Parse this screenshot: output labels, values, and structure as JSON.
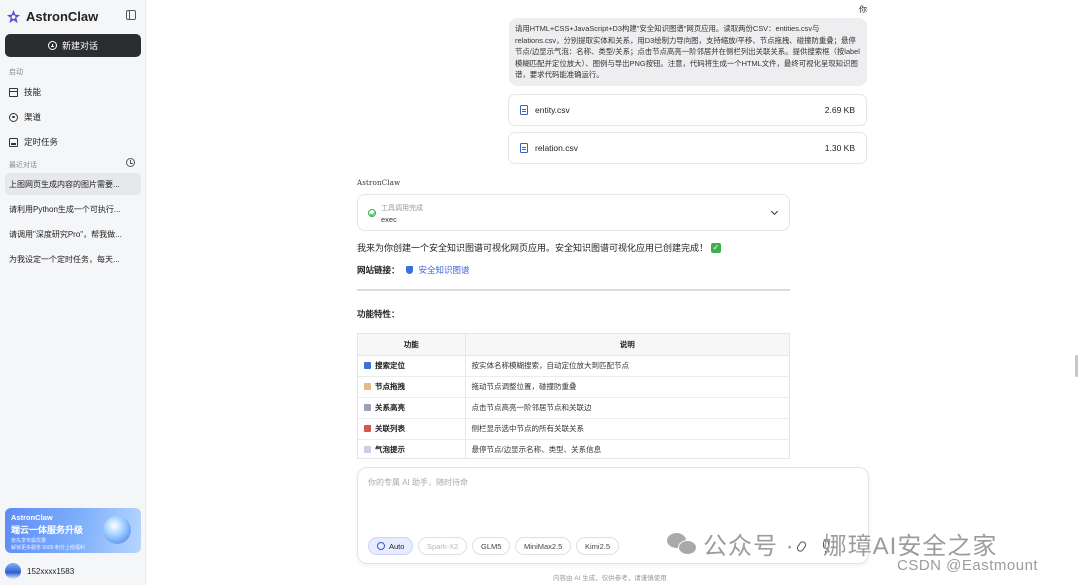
{
  "sidebar": {
    "brand": "AstronClaw",
    "new_chat": "新建对话",
    "start_label": "启动",
    "nav": [
      {
        "label": "技能",
        "icon": "skill-icon"
      },
      {
        "label": "渠道",
        "icon": "channel-icon"
      },
      {
        "label": "定时任务",
        "icon": "task-icon"
      }
    ],
    "recent_label": "最近对话",
    "conversations": [
      "上图网页生成内容的图片需要...",
      "请利用Python生成一个可执行...",
      "请调用\"深度研究Pro\"，帮我做...",
      "为我设定一个定时任务，每天..."
    ],
    "promo": {
      "title": "AstronClaw",
      "subtitle": "端云一体服务升级",
      "line1": "抢先享专属优惠",
      "line2": "解锁更多服务 5000 积分上线福利"
    },
    "user": "152xxxx1583"
  },
  "chat": {
    "you_label": "你",
    "user_message": "请用HTML+CSS+JavaScript+D3构建\"安全知识图谱\"网页应用。读取两份CSV：entities.csv与relations.csv，分别提取实体和关系，用D3绘制力导向图，支持缩放/平移、节点拖拽、碰撞防重叠；悬停节点/边显示气泡：名称、类型/关系；点击节点高亮一阶邻居并在侧栏列出关联关系。提供搜索框（按label模糊匹配并定位放大）、图例与导出PNG按钮。注意，代码将生成一个HTML文件，最终可视化呈现知识图谱，要求代码能准确运行。",
    "files": [
      {
        "name": "entity.csv",
        "size": "2.69 KB"
      },
      {
        "name": "relation.csv",
        "size": "1.30 KB"
      }
    ],
    "assistant_name": "AstronClaw",
    "tool": {
      "title": "工具调用完成",
      "name": "exec"
    },
    "reply": "我来为你创建一个安全知识图谱可视化网页应用。安全知识图谱可视化应用已创建完成！",
    "site_label": "网站链接：",
    "site_link": "安全知识图谱",
    "features_title": "功能特性：",
    "table": {
      "headers": [
        "功能",
        "说明"
      ],
      "rows": [
        {
          "feature": "搜索定位",
          "desc": "按实体名称模糊搜索，自动定位放大到匹配节点",
          "icon": "magnifier-icon",
          "color": "#3d6fd8"
        },
        {
          "feature": "节点拖拽",
          "desc": "拖动节点调整位置，碰撞防重叠",
          "icon": "hand-icon",
          "color": "#e2b88e"
        },
        {
          "feature": "关系高亮",
          "desc": "点击节点高亮一阶邻居节点和关联边",
          "icon": "link-icon",
          "color": "#9aa3b5"
        },
        {
          "feature": "关联列表",
          "desc": "侧栏显示选中节点的所有关联关系",
          "icon": "list-icon",
          "color": "#d9534f"
        },
        {
          "feature": "气泡提示",
          "desc": "悬停节点/边显示名称、类型、关系信息",
          "icon": "speech-bubble-icon",
          "color": "#c7cfe0"
        }
      ]
    }
  },
  "composer": {
    "placeholder": "你的专属 AI 助手，随时待命",
    "models": [
      {
        "label": "Auto",
        "state": "active"
      },
      {
        "label": "Spark-X2",
        "state": "disabled"
      },
      {
        "label": "GLM5",
        "state": "normal"
      },
      {
        "label": "MiniMax2.5",
        "state": "normal"
      },
      {
        "label": "Kimi2.5",
        "state": "normal"
      }
    ],
    "footer": "内容由 AI 生成，仅供参考，请谨慎使用"
  },
  "watermark": {
    "wechat_text": "公众号 ·",
    "account": "娜璋AI安全之家",
    "csdn": "CSDN @Eastmount"
  },
  "colors": {
    "accent": "#3a5fd9",
    "new_chat_bg": "#2b2d31",
    "success": "#2fb344"
  }
}
